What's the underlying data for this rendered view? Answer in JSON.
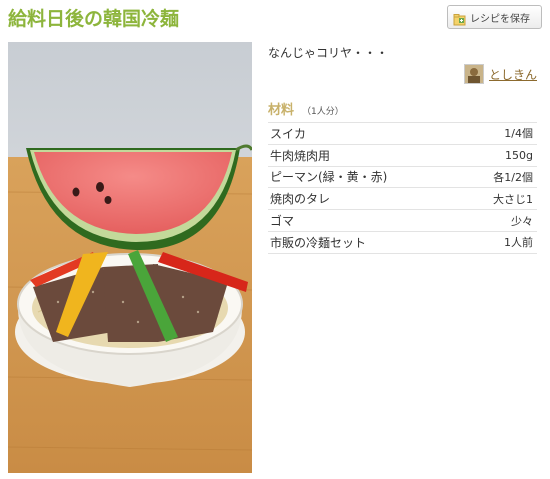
{
  "recipe": {
    "title": "給料日後の韓国冷麺",
    "save_label": "レシピを保存",
    "description": "なんじゃコリヤ・・・",
    "author_name": "としきん"
  },
  "ingredients": {
    "heading": "材料",
    "servings": "（1人分）",
    "items": [
      {
        "name": "スイカ",
        "qty": "1/4個"
      },
      {
        "name": "牛肉焼肉用",
        "qty": "150g"
      },
      {
        "name": "ピーマン(緑・黄・赤)",
        "qty": "各1/2個"
      },
      {
        "name": "焼肉のタレ",
        "qty": "大さじ1"
      },
      {
        "name": "ゴマ",
        "qty": "少々"
      },
      {
        "name": "市販の冷麺セット",
        "qty": "1人前"
      }
    ]
  },
  "colors": {
    "title_green": "#8db53c",
    "heading_gold": "#c8b16a",
    "author_brown": "#8c6a2e"
  }
}
